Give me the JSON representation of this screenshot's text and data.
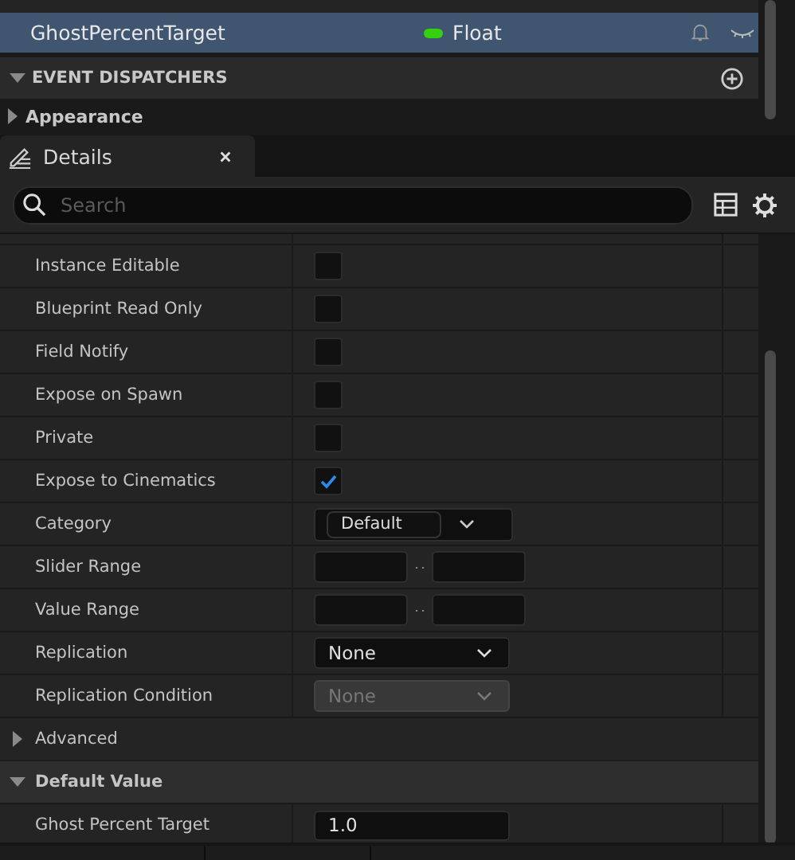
{
  "variable": {
    "name": "GhostPercentTarget",
    "type": "Float",
    "selected": true
  },
  "event_dispatchers": {
    "label": "EVENT DISPATCHERS",
    "expanded": true
  },
  "appearance": {
    "label": "Appearance",
    "expanded": false
  },
  "details_tab": {
    "title": "Details"
  },
  "search": {
    "placeholder": "Search"
  },
  "properties": [
    {
      "kind": "checkbox",
      "label": "Instance Editable",
      "checked": false
    },
    {
      "kind": "checkbox",
      "label": "Blueprint Read Only",
      "checked": false
    },
    {
      "kind": "checkbox",
      "label": "Field Notify",
      "checked": false
    },
    {
      "kind": "checkbox",
      "label": "Expose on Spawn",
      "checked": false
    },
    {
      "kind": "checkbox",
      "label": "Private",
      "checked": false
    },
    {
      "kind": "checkbox",
      "label": "Expose to Cinematics",
      "checked": true
    },
    {
      "kind": "combo",
      "label": "Category",
      "value": "Default"
    },
    {
      "kind": "range",
      "label": "Slider Range"
    },
    {
      "kind": "range",
      "label": "Value Range"
    },
    {
      "kind": "dropdown",
      "label": "Replication",
      "value": "None",
      "disabled": false
    },
    {
      "kind": "dropdown",
      "label": "Replication Condition",
      "value": "None",
      "disabled": true
    },
    {
      "kind": "section",
      "label": "Advanced",
      "expanded": false
    },
    {
      "kind": "section",
      "label": "Default Value",
      "expanded": true
    },
    {
      "kind": "text",
      "label": "Ghost Percent Target",
      "value": "1.0"
    }
  ]
}
